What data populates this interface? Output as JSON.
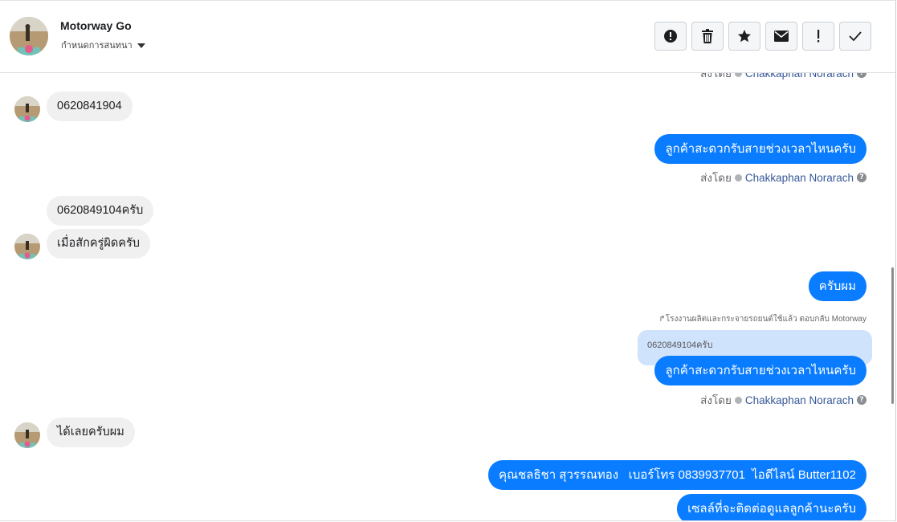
{
  "header": {
    "name": "Motorway Go",
    "conversation_setting": "กำหนดการสนทนา",
    "actions": [
      {
        "name": "report",
        "icon": "alert-circle-icon"
      },
      {
        "name": "delete",
        "icon": "trash-icon"
      },
      {
        "name": "star",
        "icon": "star-icon"
      },
      {
        "name": "mark-unread",
        "icon": "envelope-icon"
      },
      {
        "name": "follow-up",
        "icon": "exclamation-icon"
      },
      {
        "name": "done",
        "icon": "checkmark-icon"
      }
    ]
  },
  "messages": {
    "top_sentby": {
      "prefix": "ส่งโดย",
      "agent": "Chakkaphan Norarach"
    },
    "m1": "0620841904",
    "m2": "ลูกค้าสะดวกรับสายช่วงเวลาไหนครับ",
    "m2_sentby": {
      "prefix": "ส่งโดย",
      "agent": "Chakkaphan Norarach"
    },
    "m3": "0620849104ครับ",
    "m4": "เมื่อสักครู่ผิดครับ",
    "m5": "ครับผม",
    "reply_note": "โรงงานผลิตและกระจายรถยนต์ใช้แล้ว ตอบกลับ Motorway",
    "reply_quote": "0620849104ครับ",
    "m6": "ลูกค้าสะดวกรับสายช่วงเวลาไหนครับ",
    "m6_sentby": {
      "prefix": "ส่งโดย",
      "agent": "Chakkaphan Norarach"
    },
    "m7": "ได้เลยครับผม",
    "m8": "คุณชลธิชา สุวรรณทอง   เบอร์โทร 0839937701  ไอดีไลน์ Butter1102",
    "m9": "เซลล์ที่จะติดต่อดูแลลูกค้านะครับ"
  },
  "colors": {
    "outgoing_bubble": "#0a7cff",
    "incoming_bubble": "#f0f0f0",
    "reply_quote_bg": "#cfe3fd",
    "agent_link": "#385898"
  }
}
